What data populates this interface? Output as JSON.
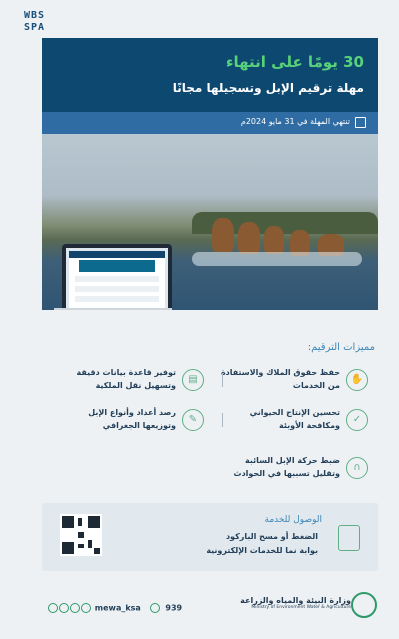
{
  "logo": {
    "line1": "WBS",
    "line2": "SPA"
  },
  "hero": {
    "headline": "30 يومًا على انتهاء",
    "subheadline": "مهلة ترقيم الإبل وتسجيلها مجانًا",
    "deadline": "تنتهي المهلة في 31 مايو 2024م"
  },
  "features": {
    "title": "مميزات الترقيم:",
    "items": [
      {
        "text": "حفظ حقوق الملاك والاستفادة من الخدمات",
        "icon": "handshake-icon"
      },
      {
        "text": "توفير قاعدة بيانات دقيقة وتسهيل نقل الملكية",
        "icon": "database-icon"
      },
      {
        "text": "تحسين الإنتاج الحيواني ومكافحة الأوبئة",
        "icon": "shield-check-icon"
      },
      {
        "text": "رصد أعداد وأنواع الإبل وتوزيعها الجغرافي",
        "icon": "document-edit-icon"
      },
      {
        "text": "ضبط حركة الإبل السائبة وتقليل تسببها في الحوادث",
        "icon": "camel-icon"
      }
    ]
  },
  "access": {
    "title": "الوصول للخدمة",
    "items": [
      "الضغط أو مسح الباركود",
      "بوابة نما للخدمات الإلكترونية"
    ]
  },
  "footer": {
    "handle": "mewa_ksa",
    "phone": "939",
    "ministry_ar": "وزارة البيئة والمياه والزراعة",
    "ministry_en": "Ministry of Environment Water & Agriculture"
  },
  "colors": {
    "navy": "#0d4870",
    "accent_green": "#58d27a",
    "bar_blue": "#2f6ca3"
  }
}
